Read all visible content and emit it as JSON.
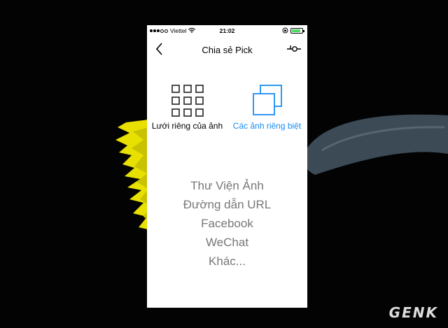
{
  "status_bar": {
    "carrier": "Viettel",
    "time": "21:02"
  },
  "nav": {
    "title": "Chia sẻ Pick",
    "back_icon": "chevron-left-icon",
    "settings_icon": "slider-settings-icon"
  },
  "options": [
    {
      "label": "Lưới riêng của ảnh",
      "icon": "grid-icon",
      "color": "#000000"
    },
    {
      "label": "Các ảnh riêng biệt",
      "icon": "stacked-squares-icon",
      "color": "#1a8cf0"
    }
  ],
  "share_targets": [
    "Thư Viện Ảnh",
    "Đường dẫn URL",
    "Facebook",
    "WeChat",
    "Khác..."
  ],
  "watermark": "GENK"
}
